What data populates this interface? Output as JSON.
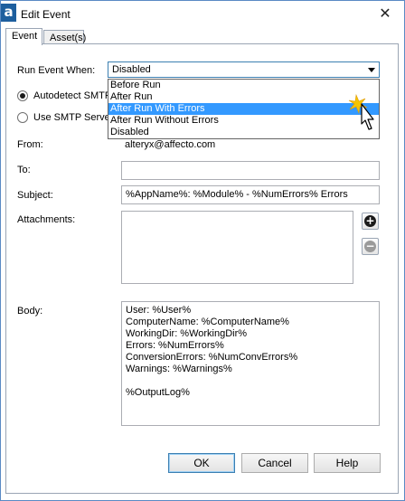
{
  "window": {
    "title": "Edit Event",
    "app_icon_letter": "a",
    "close_glyph": "✕"
  },
  "tabs": [
    {
      "label": "Event",
      "active": true
    },
    {
      "label": "Asset(s)",
      "active": false
    }
  ],
  "run_event": {
    "label": "Run Event When:",
    "selected": "Disabled",
    "options": [
      "Before Run",
      "After Run",
      "After Run With Errors",
      "After Run Without Errors",
      "Disabled"
    ],
    "highlighted": "After Run With Errors"
  },
  "smtp": {
    "autodetect_label": "Autodetect SMTP",
    "use_label": "Use SMTP Server"
  },
  "form": {
    "from_label": "From:",
    "from_value": "alteryx@affecto.com",
    "to_label": "To:",
    "to_value": "",
    "subject_label": "Subject:",
    "subject_value": "%AppName%: %Module% - %NumErrors% Errors",
    "attachments_label": "Attachments:",
    "body_label": "Body:",
    "body_lines": [
      "User: %User%",
      "ComputerName: %ComputerName%",
      "WorkingDir: %WorkingDir%",
      "Errors: %NumErrors%",
      "ConversionErrors: %NumConvErrors%",
      "Warnings: %Warnings%",
      "",
      "%OutputLog%"
    ]
  },
  "attachment_buttons": {
    "add_glyph": "+",
    "remove_glyph": "−"
  },
  "buttons": {
    "ok": "OK",
    "cancel": "Cancel",
    "help": "Help"
  },
  "colors": {
    "highlight": "#3399ff",
    "add_icon": "#1a1a1a",
    "remove_icon": "#9a9a9a",
    "cursor_burst": "#f5c400"
  }
}
